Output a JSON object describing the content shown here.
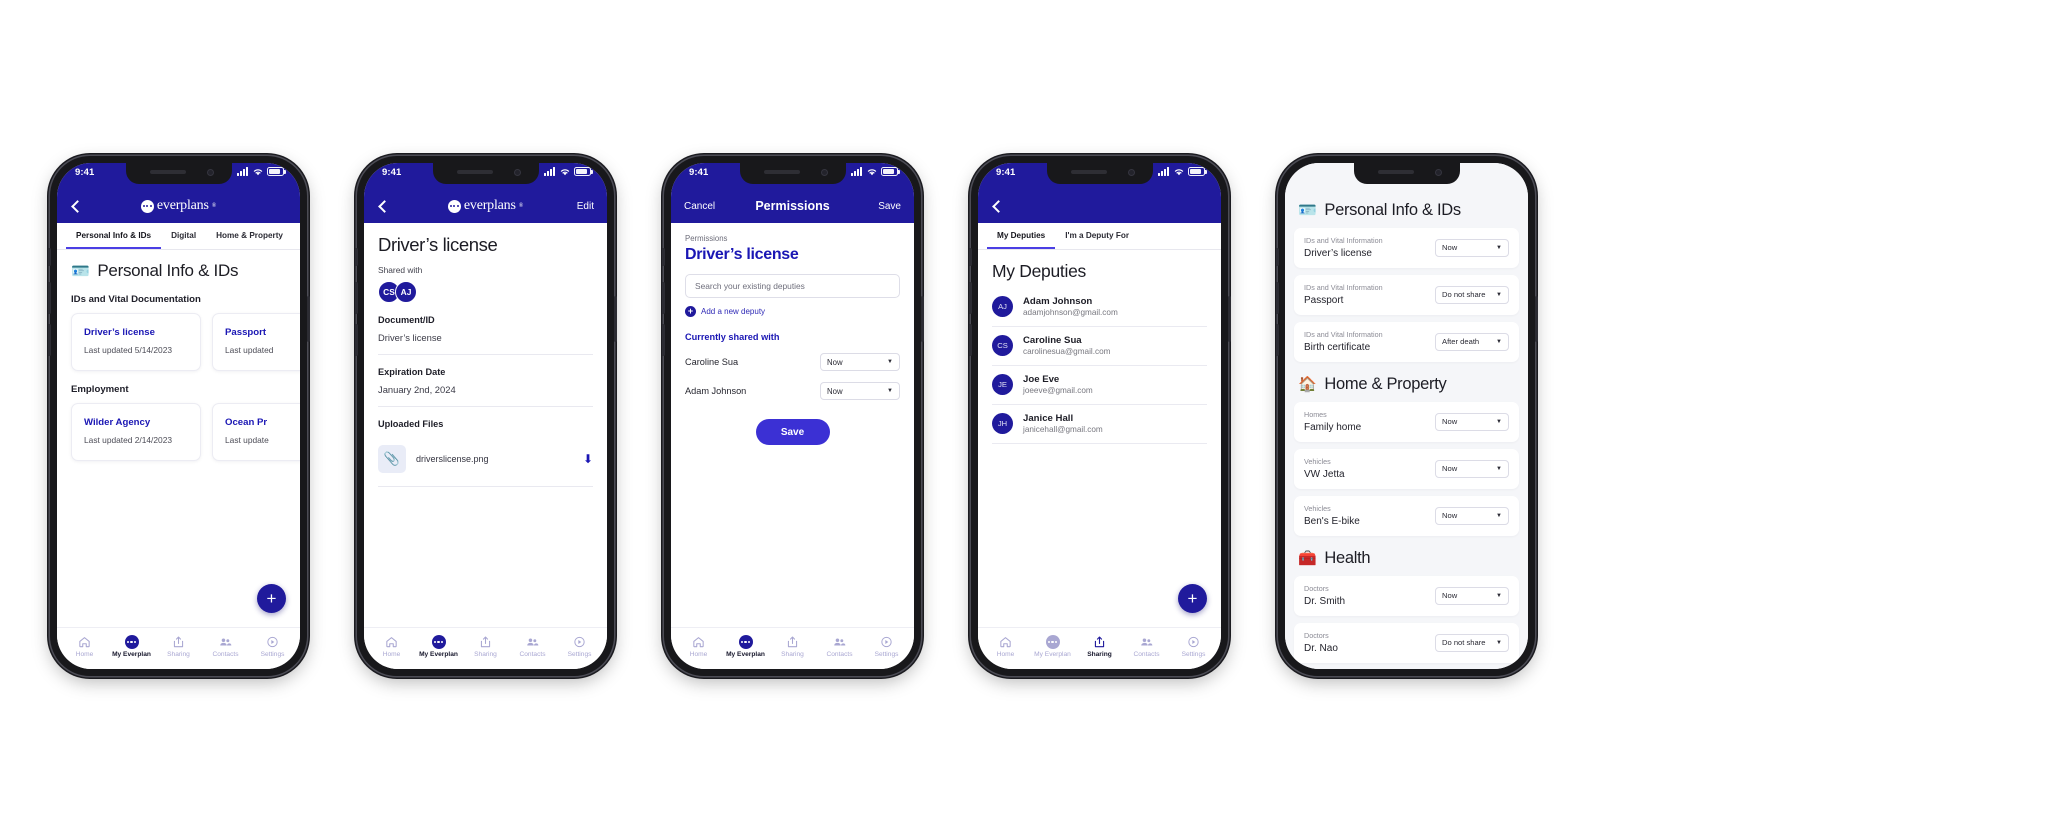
{
  "status_bar": {
    "time": "9:41"
  },
  "brand": {
    "name": "everplans",
    "registered": "®"
  },
  "phone1": {
    "nav": {
      "back_icon": "chevron-left-icon"
    },
    "tabs": [
      {
        "label": "Personal Info & IDs",
        "active": true
      },
      {
        "label": "Digital",
        "active": false
      },
      {
        "label": "Home & Property",
        "active": false
      }
    ],
    "page_title": "Personal Info & IDs",
    "page_icon": "🪪",
    "sections": [
      {
        "heading": "IDs and Vital Documentation",
        "cards": [
          {
            "title": "Driver’s license",
            "subtitle": "Last updated 5/14/2023"
          },
          {
            "title": "Passport",
            "subtitle": "Last updated"
          }
        ]
      },
      {
        "heading": "Employment",
        "cards": [
          {
            "title": "Wilder Agency",
            "subtitle": "Last updated 2/14/2023"
          },
          {
            "title": "Ocean Pr",
            "subtitle": "Last update"
          }
        ]
      }
    ],
    "fab_label": "+"
  },
  "phone2": {
    "nav": {
      "back_icon": "chevron-left-icon",
      "edit_label": "Edit"
    },
    "title": "Driver’s license",
    "shared_with_label": "Shared with",
    "avatars": [
      "CS",
      "AJ"
    ],
    "fields": [
      {
        "key": "Document/ID",
        "value": "Driver’s license"
      },
      {
        "key": "Expiration Date",
        "value": "January 2nd, 2024"
      }
    ],
    "uploaded_files_label": "Uploaded Files",
    "file": {
      "name": "driverslicense.png",
      "icon": "paperclip-icon",
      "download_icon": "download-icon"
    }
  },
  "phone3": {
    "nav": {
      "cancel_label": "Cancel",
      "title": "Permissions",
      "save_label": "Save"
    },
    "breadcrumb": "Permissions",
    "title": "Driver’s license",
    "search_placeholder": "Search your existing deputies",
    "add_deputy_label": "Add a new deputy",
    "shared_heading": "Currently shared with",
    "rows": [
      {
        "name": "Caroline Sua",
        "permission": "Now"
      },
      {
        "name": "Adam Johnson",
        "permission": "Now"
      }
    ],
    "save_button": "Save"
  },
  "phone4": {
    "nav": {
      "back_icon": "chevron-left-icon"
    },
    "tabs": [
      {
        "label": "My Deputies",
        "active": true
      },
      {
        "label": "I'm a Deputy For",
        "active": false
      }
    ],
    "title": "My Deputies",
    "deputies": [
      {
        "initials": "AJ",
        "name": "Adam Johnson",
        "email": "adamjohnson@gmail.com"
      },
      {
        "initials": "CS",
        "name": "Caroline Sua",
        "email": "carolinesua@gmail.com"
      },
      {
        "initials": "JE",
        "name": "Joe Eve",
        "email": "joeeve@gmail.com"
      },
      {
        "initials": "JH",
        "name": "Janice Hall",
        "email": "janicehall@gmail.com"
      }
    ],
    "fab_label": "+"
  },
  "phone5": {
    "groups": [
      {
        "icon": "🪪",
        "heading": "Personal Info & IDs",
        "items": [
          {
            "category": "IDs and Vital Information",
            "title": "Driver’s license",
            "permission": "Now"
          },
          {
            "category": "IDs and Vital Information",
            "title": "Passport",
            "permission": "Do not share"
          },
          {
            "category": "IDs and Vital Information",
            "title": "Birth certificate",
            "permission": "After death"
          }
        ]
      },
      {
        "icon": "🏠",
        "heading": "Home & Property",
        "items": [
          {
            "category": "Homes",
            "title": "Family home",
            "permission": "Now"
          },
          {
            "category": "Vehicles",
            "title": "VW Jetta",
            "permission": "Now"
          },
          {
            "category": "Vehicles",
            "title": "Ben's E-bike",
            "permission": "Now"
          }
        ]
      },
      {
        "icon": "🧰",
        "heading": "Health",
        "items": [
          {
            "category": "Doctors",
            "title": "Dr. Smith",
            "permission": "Now"
          },
          {
            "category": "Doctors",
            "title": "Dr. Nao",
            "permission": "Do not share"
          }
        ]
      }
    ]
  },
  "bottom_nav": {
    "items": [
      {
        "label": "Home",
        "icon": "home-icon",
        "active": false
      },
      {
        "label": "My Everplan",
        "icon": "everplans-dots-icon",
        "active": true
      },
      {
        "label": "Sharing",
        "icon": "share-icon",
        "active": false
      },
      {
        "label": "Contacts",
        "icon": "contacts-icon",
        "active": false
      },
      {
        "label": "Settings",
        "icon": "settings-icon",
        "active": false
      }
    ]
  },
  "colors": {
    "brand_blue": "#201a9c",
    "accent_violet": "#4b3fe4",
    "link_blue": "#1a16b4"
  }
}
